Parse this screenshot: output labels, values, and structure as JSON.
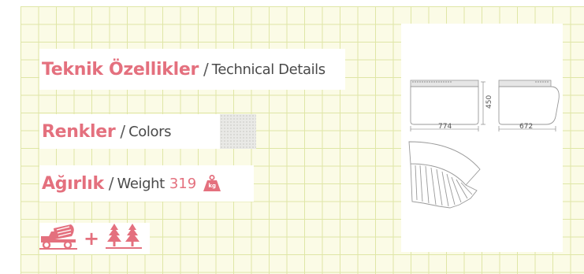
{
  "technical": {
    "tr": "Teknik Özellikler",
    "sep": "/",
    "en": "Technical Details"
  },
  "colors": {
    "tr": "Renkler",
    "sep": "/",
    "en": "Colors",
    "swatch_color": "#e9e9e6"
  },
  "weight": {
    "tr": "Ağırlık",
    "sep": "/",
    "en": "Weight",
    "value": "319",
    "unit_icon": "kg-weight-icon",
    "unit_label": "kg"
  },
  "eco": {
    "icons": [
      "concrete-mixer-truck-icon",
      "trees-icon"
    ],
    "plus": "+"
  },
  "drawing": {
    "width": "774",
    "height": "450",
    "depth": "672"
  },
  "accent_color": "#e4707e"
}
